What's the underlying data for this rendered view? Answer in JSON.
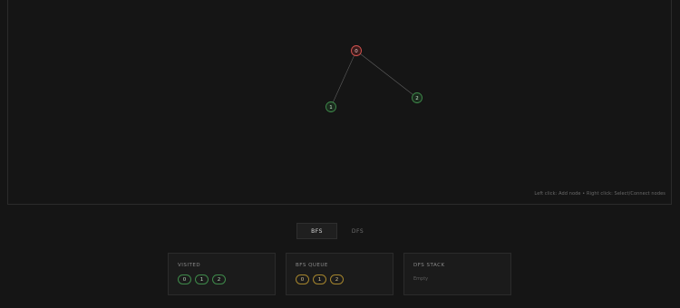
{
  "canvas": {
    "hint": "Left click: Add node • Right click: Select/Connect nodes",
    "nodes": [
      {
        "id": "0",
        "label": "0",
        "state": "current",
        "color": "#d9534f"
      },
      {
        "id": "1",
        "label": "1",
        "state": "visited",
        "color": "#3e8a4a"
      },
      {
        "id": "2",
        "label": "2",
        "state": "visited",
        "color": "#3e8a4a"
      }
    ],
    "edges": [
      {
        "from": "0",
        "to": "1"
      },
      {
        "from": "0",
        "to": "2"
      }
    ]
  },
  "tabs": [
    {
      "label": "BFS",
      "active": true
    },
    {
      "label": "DFS",
      "active": false
    }
  ],
  "panels": {
    "visited": {
      "title": "VISITED",
      "items": [
        "0",
        "1",
        "2"
      ]
    },
    "queue": {
      "title": "BFS QUEUE",
      "items": [
        "0",
        "1",
        "2"
      ]
    },
    "stack": {
      "title": "DFS STACK",
      "empty_text": "Empty"
    }
  }
}
